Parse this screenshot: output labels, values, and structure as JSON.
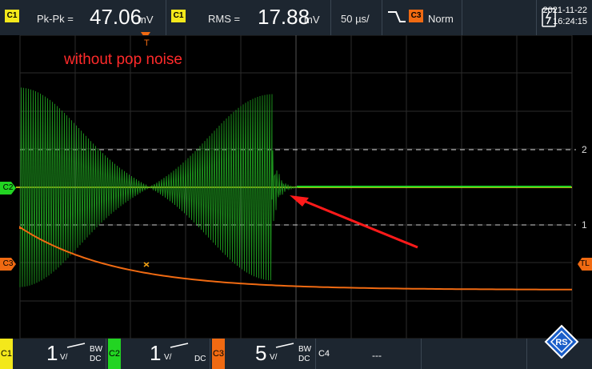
{
  "measure1": {
    "channel": "C1",
    "label": "Pk-Pk =",
    "value": "47.06",
    "unit": "mV"
  },
  "measure2": {
    "channel": "C1",
    "label": "RMS =",
    "value": "17.88",
    "unit": "mV"
  },
  "timebase": "50 µs/",
  "trigger": {
    "source": "C3",
    "mode": "Norm",
    "marker": "T"
  },
  "datetime": {
    "date": "2021-11-22",
    "time": "16:24:15"
  },
  "annotation": "without pop noise",
  "markers": {
    "c2": "C2",
    "c3": "C3",
    "trigger_level": "TL",
    "grid_2": "2",
    "grid_1": "1"
  },
  "channels": [
    {
      "tag": "C1",
      "scale": "1",
      "unit": "V/",
      "bw": "BW",
      "coupling": "DC",
      "color": "#f3e81b"
    },
    {
      "tag": "C2",
      "scale": "1",
      "unit": "V/",
      "bw": "",
      "coupling": "DC",
      "color": "#22d422"
    },
    {
      "tag": "C3",
      "scale": "5",
      "unit": "V/",
      "bw": "BW",
      "coupling": "DC",
      "color": "#f06a12"
    },
    {
      "tag": "C4",
      "scale": "---",
      "unit": "",
      "bw": "",
      "coupling": "",
      "color": "#ffffff"
    }
  ],
  "colors": {
    "c1": "#f3e81b",
    "c2": "#22d422",
    "c3": "#f06a12",
    "arrow": "#ff1a1a",
    "annotation": "#ff2a2a"
  }
}
